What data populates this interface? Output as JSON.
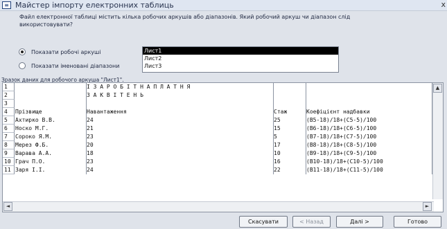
{
  "window": {
    "title": "Майстер імпорту електронних таблиць",
    "close": "x"
  },
  "question": "Файл електронної таблиці містить кілька робочих аркушів або діапазонів. Який робочий аркуш чи діапазон слід використовувати?",
  "options": {
    "show_sheets": "Показати робочі аркуші",
    "show_ranges": "Показати іменовані діапазони"
  },
  "sheets": [
    "Лист1",
    "Лист2",
    "Лист3"
  ],
  "preview_label": "Зразок даних для робочого аркуша \"Лист1\".",
  "grid": {
    "rows": [
      {
        "n": "1",
        "c1": "",
        "c2": "І         З А Р О Б І Т Н А   П Л А Т Н Я",
        "c3": "",
        "c4": ""
      },
      {
        "n": "2",
        "c1": "",
        "c2": "                      З А   К В І Т Е Н Ь",
        "c3": "",
        "c4": ""
      },
      {
        "n": "3",
        "c1": "",
        "c2": "",
        "c3": "",
        "c4": ""
      },
      {
        "n": "4",
        "c1": "Прізвище",
        "c2": "Навантаження",
        "c3": "Стаж",
        "c4": "Коефіцієнт надбавки"
      },
      {
        "n": "5",
        "c1": "Ахтирко В.В.",
        "c2": "24",
        "c3": "25",
        "c4": "(B5-18)/18+(C5-5)/100"
      },
      {
        "n": "6",
        "c1": "Носко М.Г.",
        "c2": "21",
        "c3": "15",
        "c4": "(B6-18)/18+(C6-5)/100"
      },
      {
        "n": "7",
        "c1": "Сороко Я.М.",
        "c2": "23",
        "c3": "5",
        "c4": "(B7-18)/18+(C7-5)/100"
      },
      {
        "n": "8",
        "c1": "Мерез Ф.Б.",
        "c2": "20",
        "c3": "17",
        "c4": "(B8-18)/18+(C8-5)/100"
      },
      {
        "n": "9",
        "c1": "Варава А.А.",
        "c2": "18",
        "c3": "10",
        "c4": "(B9-18)/18+(C9-5)/100"
      },
      {
        "n": "10",
        "c1": "Грач П.О.",
        "c2": "23",
        "c3": "16",
        "c4": "(B10-18)/18+(C10-5)/100"
      },
      {
        "n": "11",
        "c1": "Заря І.І.",
        "c2": "24",
        "c3": "22",
        "c4": "(B11-18)/18+(C11-5)/100"
      }
    ]
  },
  "buttons": {
    "cancel": "Скасувати",
    "back": "< Назад",
    "next": "Далі >",
    "finish": "Готово"
  },
  "scroll_glyphs": {
    "up": "▲",
    "left": "◄",
    "right": "►"
  }
}
